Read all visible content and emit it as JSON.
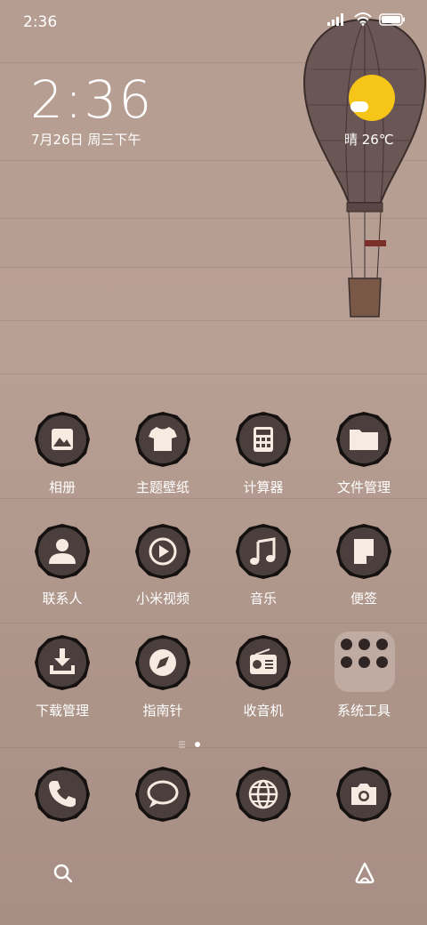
{
  "status_bar": {
    "time": "2:36",
    "icons": [
      "signal-icon",
      "wifi-icon",
      "battery-icon"
    ]
  },
  "clock_widget": {
    "time": "2:36",
    "date": "7月26日 周三下午"
  },
  "weather_widget": {
    "condition": "晴",
    "temperature": "26℃",
    "text": "晴 26℃",
    "icon": "sunny-cloud-icon",
    "sun_color": "#f5c518"
  },
  "apps": {
    "gallery": "相册",
    "themes": "主题壁纸",
    "calculator": "计算器",
    "file_manager": "文件管理",
    "contacts": "联系人",
    "mi_video": "小米视频",
    "music": "音乐",
    "notes": "便签",
    "downloads": "下载管理",
    "compass": "指南针",
    "radio": "收音机",
    "system_tools": "系统工具"
  },
  "dock": [
    "phone-icon",
    "messages-icon",
    "browser-icon",
    "camera-icon"
  ],
  "page_indicator": {
    "pages": 2,
    "current": 2
  },
  "colors": {
    "icon_fill": "#4a3f3c",
    "icon_glyph": "#f5ebe0",
    "icon_ring": "#141110"
  }
}
